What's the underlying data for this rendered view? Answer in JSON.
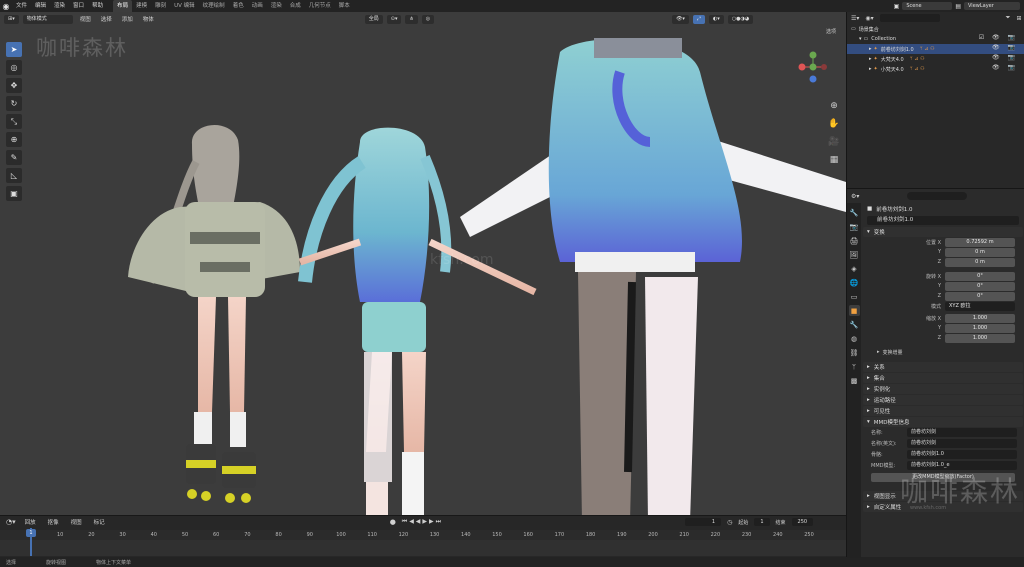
{
  "menu": [
    "文件",
    "编辑",
    "渲染",
    "窗口",
    "帮助"
  ],
  "workspaces": [
    "布局",
    "建模",
    "雕刻",
    "UV 编辑",
    "纹理绘制",
    "着色",
    "动画",
    "渲染",
    "合成",
    "几何节点",
    "脚本"
  ],
  "active_workspace_index": 0,
  "top_right": {
    "scene": "Scene",
    "view_layer": "ViewLayer"
  },
  "viewport": {
    "mode": "物体模式",
    "menus": [
      "视图",
      "选择",
      "添加",
      "物体"
    ],
    "transform_orientation": "全局",
    "options_label": "选项",
    "watermark_left": "咖啡森林",
    "watermark_center": "kfsh.com"
  },
  "tools": [
    "select-tool",
    "cursor-tool",
    "move-tool",
    "rotate-tool",
    "scale-tool",
    "transform-tool",
    "annotate-tool",
    "measure-tool",
    "add-cube-tool"
  ],
  "timeline": {
    "menus": [
      "回放",
      "抠像",
      "视图",
      "标记"
    ],
    "current_frame": "1",
    "start_label": "起始",
    "start": "1",
    "end_label": "结束",
    "end": "250",
    "ticks": [
      "1",
      "10",
      "20",
      "30",
      "40",
      "50",
      "60",
      "70",
      "80",
      "90",
      "100",
      "110",
      "120",
      "130",
      "140",
      "150",
      "160",
      "170",
      "180",
      "190",
      "200",
      "210",
      "220",
      "230",
      "240",
      "250"
    ]
  },
  "status": [
    "选择",
    "旋转视图",
    "物体上下文菜单"
  ],
  "outliner": {
    "scene_collection": "场景集合",
    "collection": "Collection",
    "objects": [
      {
        "name": "前卷坊刘剑1.0",
        "selected": true
      },
      {
        "name": "大梵天4.0",
        "selected": false
      },
      {
        "name": "小梵天4.0",
        "selected": false
      }
    ]
  },
  "properties": {
    "object_header": "前卷坊刘剑1.0",
    "object_name": "前卷坊刘剑1.0",
    "transform_label": "变换",
    "location_label": "位置 X",
    "location": [
      "0.72592 m",
      "0 m",
      "0 m"
    ],
    "rotation_label": "旋转 X",
    "rotation": [
      "0°",
      "0°",
      "0°"
    ],
    "mode_label": "模式",
    "mode_value": "XYZ 欧拉",
    "scale_label": "缩放 X",
    "scale": [
      "1.000",
      "1.000",
      "1.000"
    ],
    "axis_y": "Y",
    "axis_z": "Z",
    "delta_transform": "变换增量",
    "panels": [
      "关系",
      "集合",
      "实例化",
      "运动路径",
      "可见性"
    ],
    "mmd_panel": "MMD模型信息",
    "mmd_name_label": "名称:",
    "mmd_name": "前卷坊刘剑",
    "mmd_name_en_label": "名称(英文):",
    "mmd_name_en": "前卷坊刘剑",
    "mmd_rows": [
      {
        "label": "骨骼:",
        "value": "前卷坊刘剑1.0"
      },
      {
        "label": "MMD模型:",
        "value": "前卷坊刘剑1.0_e"
      }
    ],
    "mmd_button": "更改MMD模型缩放(Factor)",
    "bottom_panels": [
      "视图显示",
      "自定义属性"
    ],
    "watermark": "咖啡森林",
    "watermark_sub": "www.kfsh.com"
  },
  "colors": {
    "accent": "#4772b3",
    "selection": "#334d80",
    "viewport_bg": "#3c3c3c"
  }
}
